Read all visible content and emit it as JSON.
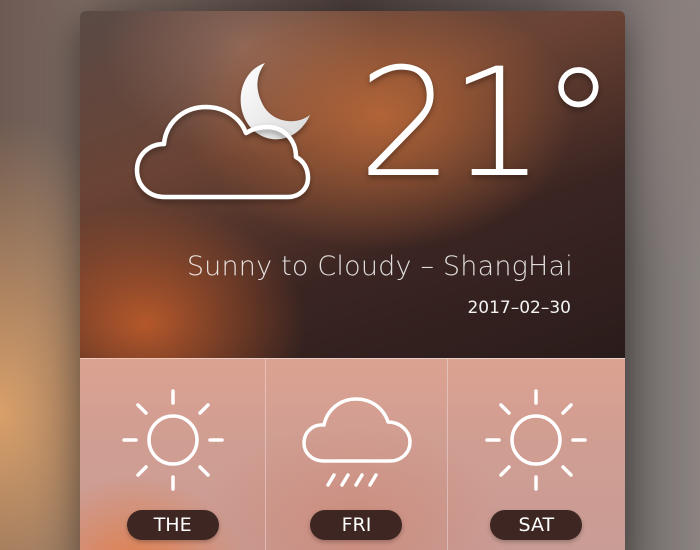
{
  "current": {
    "temperature": "21",
    "unit": "°",
    "condition": "Sunny to Cloudy – ShangHai",
    "date": "2017–02–30",
    "icon": "cloud-moon-icon"
  },
  "forecast": [
    {
      "day": "THE",
      "icon": "sun-icon"
    },
    {
      "day": "FRI",
      "icon": "cloud-rain-icon"
    },
    {
      "day": "SAT",
      "icon": "sun-icon"
    }
  ],
  "colors": {
    "label_background": "#3e2722",
    "text": "#ffffff"
  }
}
